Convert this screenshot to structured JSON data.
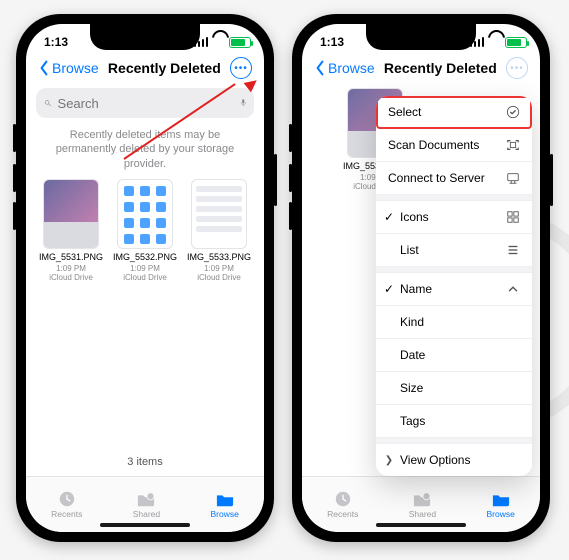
{
  "status": {
    "time": "1:13",
    "battery_label": "84"
  },
  "nav": {
    "back": "Browse",
    "title": "Recently Deleted"
  },
  "search": {
    "placeholder": "Search"
  },
  "notice": "Recently deleted items may be permanently deleted by your storage provider.",
  "files": [
    {
      "name": "IMG_5531.PNG",
      "time": "1:09 PM",
      "location": "iCloud Drive"
    },
    {
      "name": "IMG_5532.PNG",
      "time": "1:09 PM",
      "location": "iCloud Drive"
    },
    {
      "name": "IMG_5533.PNG",
      "time": "1:09 PM",
      "location": "iCloud Drive"
    }
  ],
  "footer_count": "3 items",
  "tabs": {
    "recents": "Recents",
    "shared": "Shared",
    "browse": "Browse"
  },
  "menu": {
    "select": "Select",
    "scan": "Scan Documents",
    "connect": "Connect to Server",
    "icons": "Icons",
    "list": "List",
    "name": "Name",
    "kind": "Kind",
    "date": "Date",
    "size": "Size",
    "tags": "Tags",
    "view_options": "View Options"
  }
}
